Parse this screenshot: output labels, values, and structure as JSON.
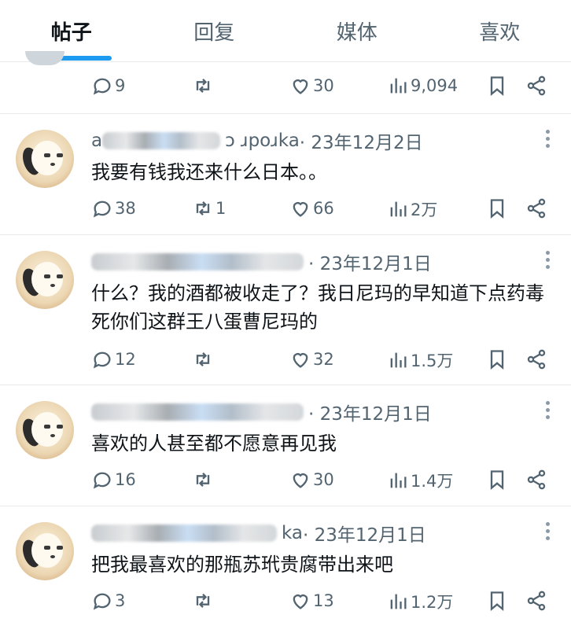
{
  "tabs": [
    {
      "label": "帖子",
      "active": true
    },
    {
      "label": "回复",
      "active": false
    },
    {
      "label": "媒体",
      "active": false
    },
    {
      "label": "喜欢",
      "active": false
    }
  ],
  "partial_post": {
    "replies": "9",
    "reposts": "",
    "likes": "30",
    "views": "9,094"
  },
  "posts": [
    {
      "handle_suffix": "a",
      "handle_tail": "ɔ ɹpoɹka",
      "date": "· 23年12月2日",
      "text": "我要有钱我还来什么日本。。",
      "replies": "38",
      "reposts": "1",
      "likes": "66",
      "views": "2万"
    },
    {
      "handle_suffix": "",
      "handle_tail": "",
      "date": "· 23年12月1日",
      "text": "什么？我的酒都被收走了？我日尼玛的早知道下点药毒死你们这群王八蛋曹尼玛的",
      "replies": "12",
      "reposts": "",
      "likes": "32",
      "views": "1.5万"
    },
    {
      "handle_suffix": "",
      "handle_tail": "",
      "date": "· 23年12月1日",
      "text": "喜欢的人甚至都不愿意再见我",
      "replies": "16",
      "reposts": "",
      "likes": "30",
      "views": "1.4万"
    },
    {
      "handle_suffix": "",
      "handle_tail": "ka",
      "date": "· 23年12月1日",
      "text": "把我最喜欢的那瓶苏玳贵腐带出来吧",
      "replies": "3",
      "reposts": "",
      "likes": "13",
      "views": "1.2万"
    }
  ],
  "colors": {
    "accent": "#1d9bf0",
    "muted": "#536471",
    "divider": "#e7e9ea"
  }
}
